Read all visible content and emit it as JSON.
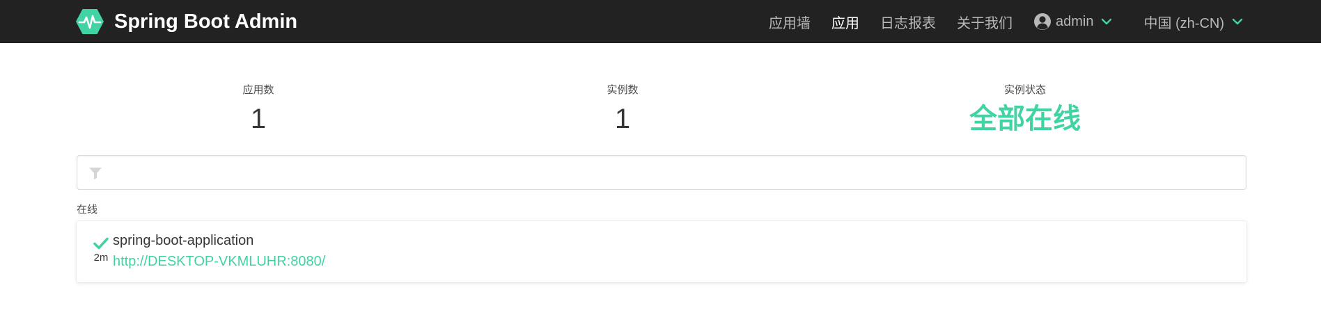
{
  "navbar": {
    "brand_title": "Spring Boot Admin",
    "brand_icon": "heartbeat-hexagon-logo",
    "links": [
      {
        "label": "应用墙",
        "active": false
      },
      {
        "label": "应用",
        "active": true
      },
      {
        "label": "日志报表",
        "active": false
      },
      {
        "label": "关于我们",
        "active": false
      }
    ],
    "user": {
      "label": "admin",
      "icon": "user-circle-icon"
    },
    "language": {
      "label": "中国 (zh-CN)"
    }
  },
  "stats": {
    "applications": {
      "label": "应用数",
      "value": "1"
    },
    "instances": {
      "label": "实例数",
      "value": "1"
    },
    "status": {
      "label": "实例状态",
      "value": "全部在线"
    }
  },
  "filter": {
    "value": "",
    "placeholder": "",
    "icon": "filter-icon"
  },
  "groups": [
    {
      "label": "在线",
      "applications": [
        {
          "name": "spring-boot-application",
          "url": "http://DESKTOP-VKMLUHR:8080/",
          "uptime": "2m",
          "status_icon": "check-icon"
        }
      ]
    }
  ],
  "colors": {
    "navbar_bg": "#222222",
    "accent": "#42d3a5",
    "nav_link": "#b8b8b8",
    "nav_link_active": "#ffffff"
  }
}
